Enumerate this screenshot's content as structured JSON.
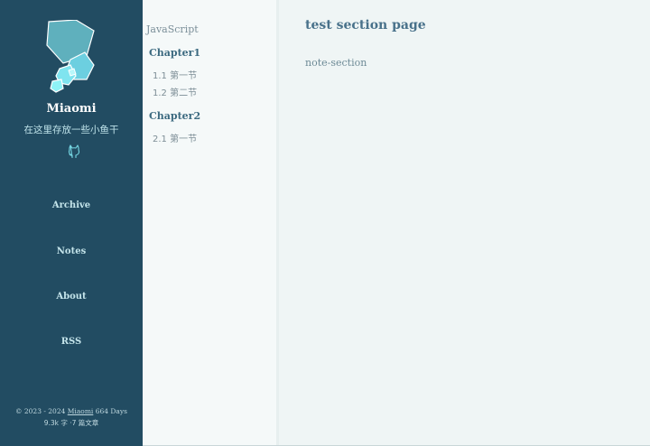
{
  "site": {
    "title": "Miaomi",
    "subtitle": "在这里存放一些小鱼干"
  },
  "nav": {
    "archive": "Archive",
    "notes": "Notes",
    "about": "About",
    "rss": "RSS"
  },
  "footer": {
    "copyright_prefix": "© 2023 - 2024 ",
    "author_link": "Miaomi",
    "days": " 664 Days",
    "stats": "9.3k 字 ·7 篇文章"
  },
  "catalog": {
    "category": "JavaScript",
    "chapters": [
      {
        "label": "Chapter1",
        "sections": [
          "1.1 第一节",
          "1.2 第二节"
        ]
      },
      {
        "label": "Chapter2",
        "sections": [
          "2.1 第一节"
        ]
      }
    ]
  },
  "main": {
    "title": "test section page",
    "body": "note-section"
  },
  "colors": {
    "sidebar_bg": "#224c62",
    "page_bg": "#eff5f5",
    "accent": "#48718a"
  },
  "icons": {
    "logo": "stacked-pentagon-logo-icon",
    "github": "github-icon"
  }
}
